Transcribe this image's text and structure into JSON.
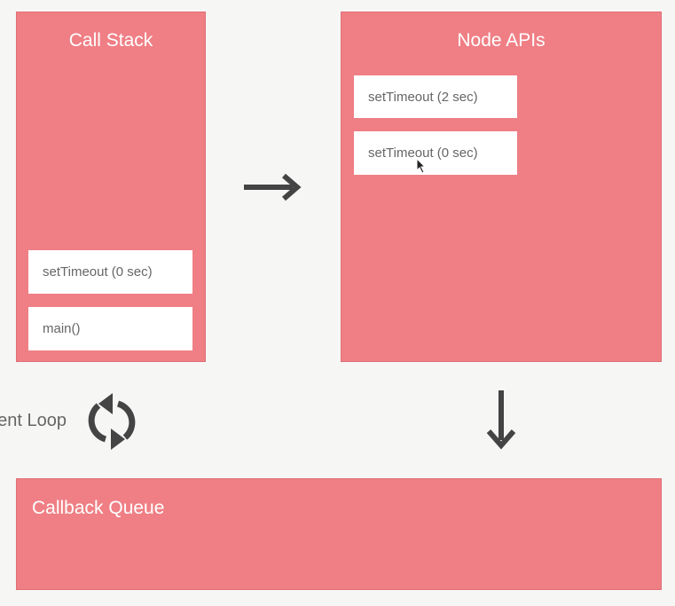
{
  "call_stack": {
    "title": "Call Stack",
    "frames": [
      "setTimeout (0 sec)",
      "main()"
    ]
  },
  "node_apis": {
    "title": "Node APIs",
    "items": [
      "setTimeout (2 sec)",
      "setTimeout (0 sec)"
    ]
  },
  "event_loop": {
    "label": "Event Loop"
  },
  "callback_queue": {
    "title": "Callback Queue"
  }
}
